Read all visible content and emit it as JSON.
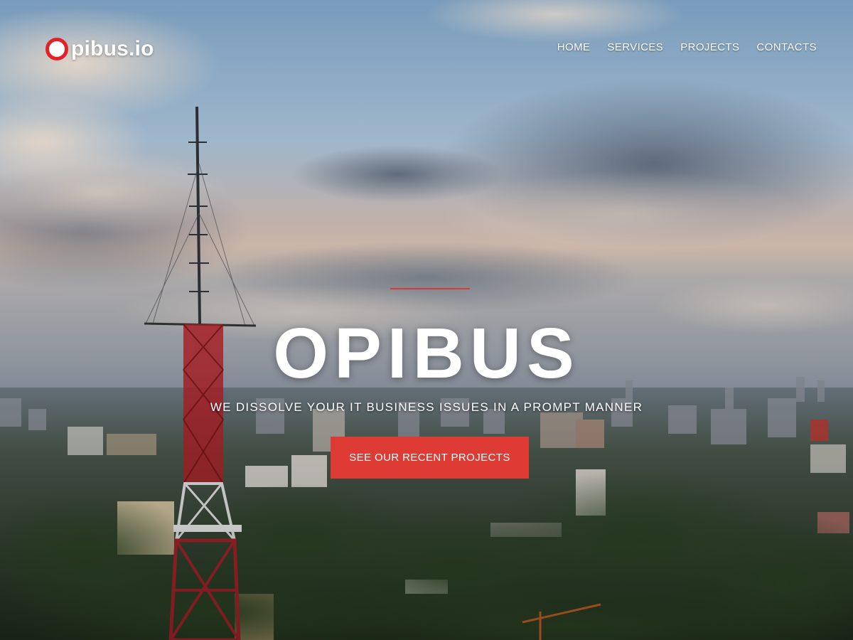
{
  "brand": {
    "name": "Opibus.io",
    "logo_text": "pibus.io",
    "accent_color": "#de3b34"
  },
  "nav": {
    "items": [
      {
        "label": "HOME"
      },
      {
        "label": "SERVICES"
      },
      {
        "label": "PROJECTS"
      },
      {
        "label": "CONTACTS"
      }
    ]
  },
  "hero": {
    "title": "OPIBUS",
    "subtitle": "WE DISSOLVE YOUR IT BUSINESS ISSUES IN A PROMPT MANNER",
    "cta_label": "SEE OUR RECENT PROJECTS"
  }
}
